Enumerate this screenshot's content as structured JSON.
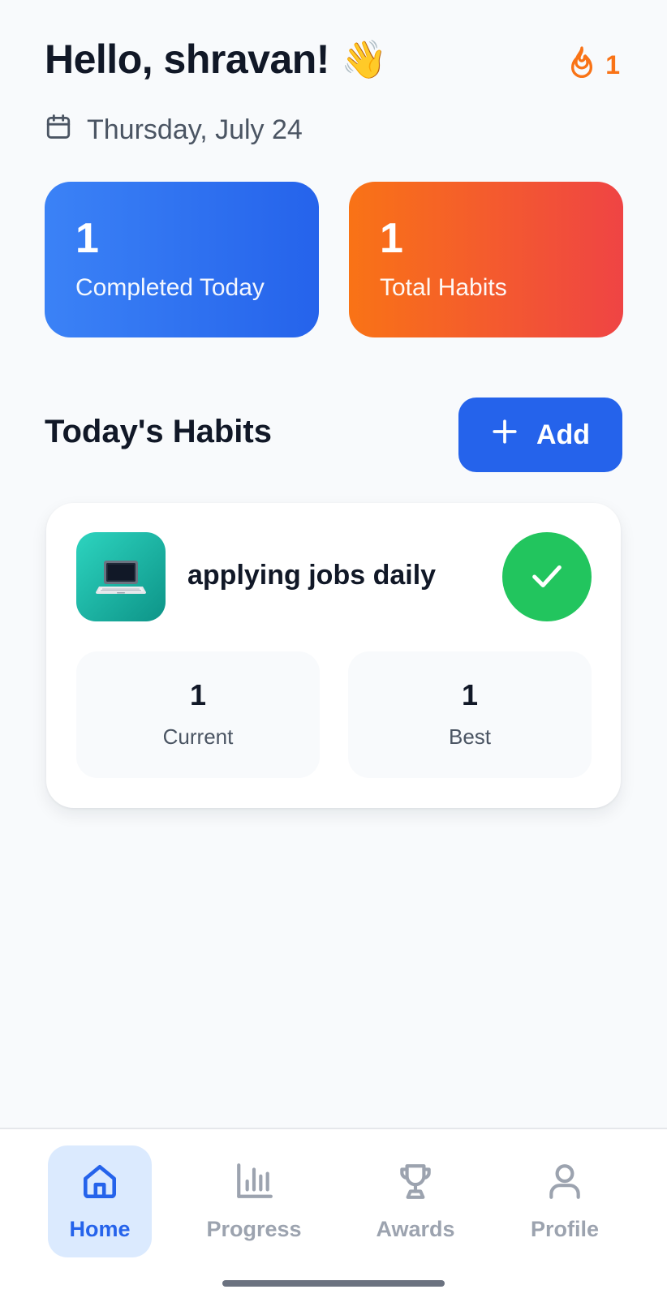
{
  "header": {
    "greeting": "Hello, shravan!",
    "greeting_emoji": "👋",
    "streak_count": "1",
    "streak_icon": "flame-icon",
    "date": "Thursday, July 24",
    "date_icon": "calendar-icon"
  },
  "stats": [
    {
      "value": "1",
      "label": "Completed Today",
      "color": "#2563eb"
    },
    {
      "value": "1",
      "label": "Total Habits",
      "color": "#f97316"
    }
  ],
  "section": {
    "title": "Today's Habits",
    "add_label": "Add",
    "add_icon": "plus-icon"
  },
  "habits": [
    {
      "icon": "💻",
      "name": "applying jobs daily",
      "completed": true,
      "current_value": "1",
      "current_label": "Current",
      "best_value": "1",
      "best_label": "Best"
    }
  ],
  "nav": {
    "items": [
      {
        "label": "Home",
        "icon": "home-icon",
        "active": true
      },
      {
        "label": "Progress",
        "icon": "bar-chart-icon",
        "active": false
      },
      {
        "label": "Awards",
        "icon": "trophy-icon",
        "active": false
      },
      {
        "label": "Profile",
        "icon": "user-icon",
        "active": false
      }
    ]
  },
  "colors": {
    "primary": "#2563eb",
    "accent_orange": "#f97316",
    "success": "#22c55e",
    "background": "#f8fafc"
  }
}
